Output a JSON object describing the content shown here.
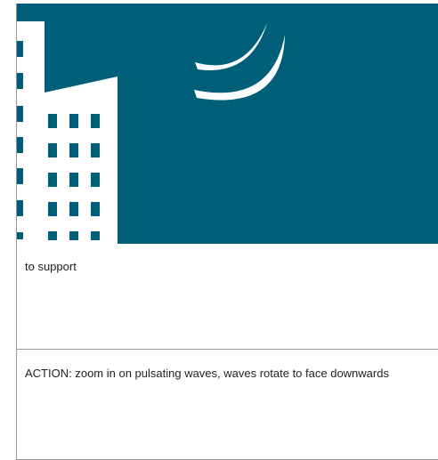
{
  "illustration": {
    "background_color": "#005f78",
    "building_color": "#ffffff",
    "icons": [
      "building-icon",
      "signal-waves-icon"
    ]
  },
  "caption": {
    "text": "to support"
  },
  "action": {
    "text": "ACTION: zoom in on pulsating waves, waves rotate to face downwards"
  }
}
